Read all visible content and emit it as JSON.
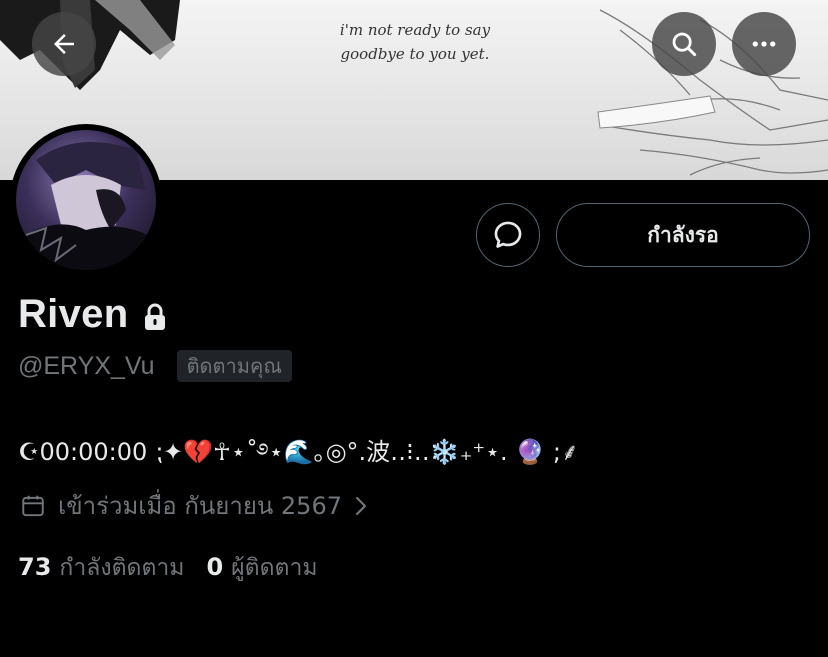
{
  "banner": {
    "quote_line1": "i'm not ready to say",
    "quote_line2": "goodbye to you yet."
  },
  "top_bar": {
    "back_icon": "arrow-left-icon",
    "search_icon": "search-icon",
    "more_icon": "more-horizontal-icon"
  },
  "profile": {
    "display_name": "Riven",
    "protected_icon": "lock-icon",
    "handle": "@ERYX_Vu",
    "follows_you_badge": "ติดตามคุณ",
    "bio": "☪︎00:00:00 ⁏✦💔☥⋆˚࿔⋆🌊｡◎°.波‥⁝‥❄️₊⁺⋆. 🔮 ;⸙",
    "joined_text": "เข้าร่วมเมื่อ กันยายน 2567",
    "joined_icon": "calendar-icon",
    "following_count": "73",
    "following_label": "กำลังติดตาม",
    "followers_count": "0",
    "followers_label": "ผู้ติดตาม"
  },
  "actions": {
    "message_icon": "message-icon",
    "pending_label": "กำลังรอ"
  },
  "colors": {
    "background": "#000000",
    "primary_text": "#e7e9ea",
    "secondary_text": "#71767b",
    "border": "#536471"
  }
}
